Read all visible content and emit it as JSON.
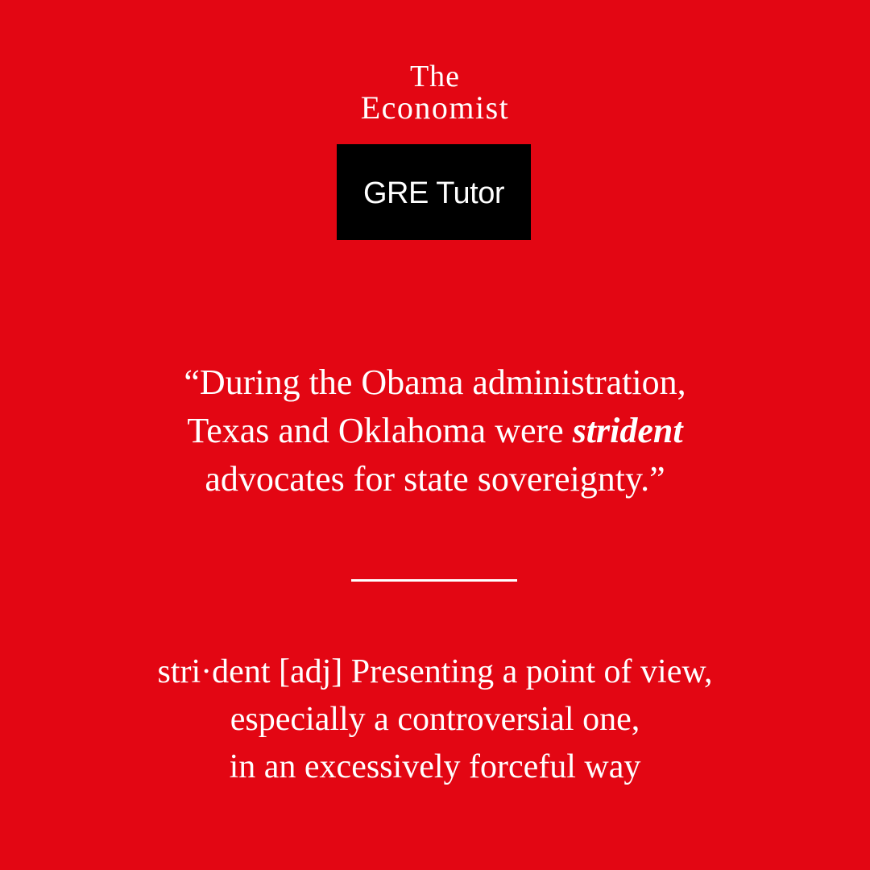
{
  "brand": {
    "line1": "The",
    "line2": "Economist"
  },
  "tag": {
    "label": "GRE Tutor"
  },
  "quote": {
    "line1": "“During the Obama administration,",
    "line2_before": "Texas and Oklahoma were ",
    "keyword": "strident",
    "line3": "advocates for state sovereignty.”"
  },
  "definition": {
    "line1": "stri·dent [adj] Presenting a point of view,",
    "line2": "especially a controversial one,",
    "line3": "in an excessively forceful way"
  },
  "colors": {
    "background": "#e30613",
    "text": "#ffffff",
    "tag_background": "#000000"
  }
}
